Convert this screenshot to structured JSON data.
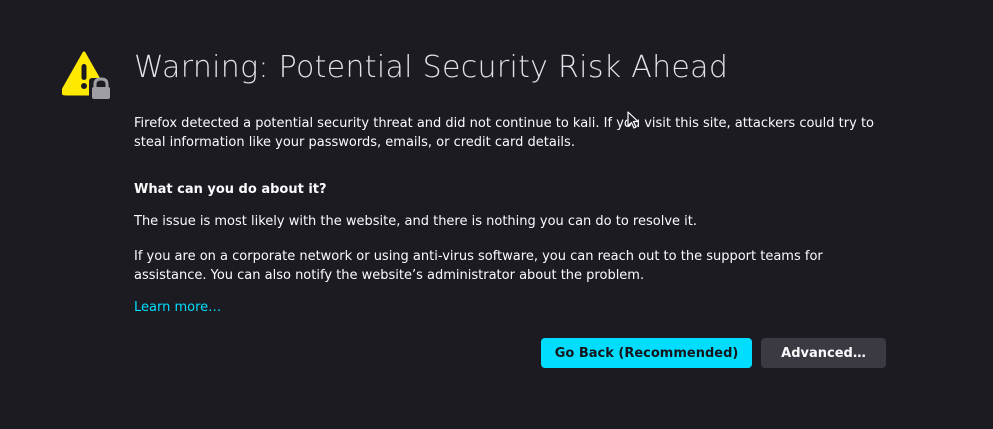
{
  "page": {
    "title": "Warning: Potential Security Risk Ahead",
    "intro": "Firefox detected a potential security threat and did not continue to kali. If you visit this site, attackers could try to steal information like your passwords, emails, or credit card details.",
    "what_heading": "What can you do about it?",
    "issue_text": "The issue is most likely with the website, and there is nothing you can do to resolve it.",
    "corporate_text": "If you are on a corporate network or using anti-virus software, you can reach out to the support teams for assistance. You can also notify the website’s administrator about the problem.",
    "learn_more": "Learn more…"
  },
  "buttons": {
    "go_back": "Go Back (Recommended)",
    "advanced": "Advanced…"
  },
  "colors": {
    "background": "#1c1b22",
    "accent": "#00ddff",
    "warning": "#ffe900",
    "secondary_button": "#3b3a42"
  },
  "icons": {
    "warning": "warning-lock-icon",
    "cursor": "mouse-cursor-icon"
  }
}
